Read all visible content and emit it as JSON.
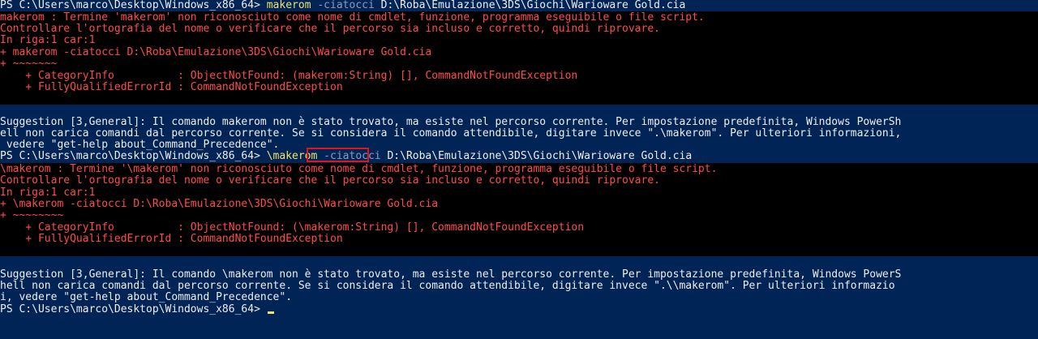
{
  "lines": [
    {
      "prompt": "PS C:\\Users\\marco\\Desktop\\Windows_x86_64> ",
      "cmd": "makerom",
      "param": " -ciatocci",
      "arg": " D:\\Roba\\Emulazione\\3DS\\Giochi\\Warioware Gold.cia"
    },
    {
      "text": "makerom : Termine 'makerom' non riconosciuto come nome di cmdlet, funzione, programma eseguibile o file script."
    },
    {
      "text": "Controllare l'ortografia del nome o verificare che il percorso sia incluso e corretto, quindi riprovare."
    },
    {
      "text": "In riga:1 car:1"
    },
    {
      "text": "+ makerom -ciatocci D:\\Roba\\Emulazione\\3DS\\Giochi\\Warioware Gold.cia"
    },
    {
      "text": "+ ~~~~~~~"
    },
    {
      "text": "    + CategoryInfo          : ObjectNotFound: (makerom:String) [], CommandNotFoundException"
    },
    {
      "text": "    + FullyQualifiedErrorId : CommandNotFoundException"
    },
    {
      "text": ""
    },
    {
      "text": ""
    },
    {
      "text": "Suggestion [3,General]: Il comando makerom non è stato trovato, ma esiste nel percorso corrente. Per impostazione predefinita, Windows PowerSh"
    },
    {
      "text": "ell non carica comandi dal percorso corrente. Se si considera il comando attendibile, digitare invece \".\\makerom\". Per ulteriori informazioni,"
    },
    {
      "text": " vedere \"get-help about_Command_Precedence\"."
    },
    {
      "prompt": "PS C:\\Users\\marco\\Desktop\\Windows_x86_64> ",
      "cmd": "\\makerom",
      "param": " -ciatocci",
      "arg": " D:\\Roba\\Emulazione\\3DS\\Giochi\\Warioware Gold.cia"
    },
    {
      "text": "\\makerom : Termine '\\makerom' non riconosciuto come nome di cmdlet, funzione, programma eseguibile o file script."
    },
    {
      "text": "Controllare l'ortografia del nome o verificare che il percorso sia incluso e corretto, quindi riprovare."
    },
    {
      "text": "In riga:1 car:1"
    },
    {
      "text": "+ \\makerom -ciatocci D:\\Roba\\Emulazione\\3DS\\Giochi\\Warioware Gold.cia"
    },
    {
      "text": "+ ~~~~~~~~"
    },
    {
      "text": "    + CategoryInfo          : ObjectNotFound: (\\makerom:String) [], CommandNotFoundException"
    },
    {
      "text": "    + FullyQualifiedErrorId : CommandNotFoundException"
    },
    {
      "text": ""
    },
    {
      "text": ""
    },
    {
      "text": "Suggestion [3,General]: Il comando \\makerom non è stato trovato, ma esiste nel percorso corrente. Per impostazione predefinita, Windows PowerS"
    },
    {
      "text": "hell non carica comandi dal percorso corrente. Se si considera il comando attendibile, digitare invece \".\\\\makerom\". Per ulteriori informazio"
    },
    {
      "text": "i, vedere \"get-help about_Command_Precedence\"."
    },
    {
      "prompt": "PS C:\\Users\\marco\\Desktop\\Windows_x86_64> "
    }
  ],
  "colors": {
    "background": "#012456",
    "error_bg": "#000000",
    "error_text": "#ff4b4b",
    "command": "#f0e26a",
    "highlight_box": "#e0161a"
  }
}
